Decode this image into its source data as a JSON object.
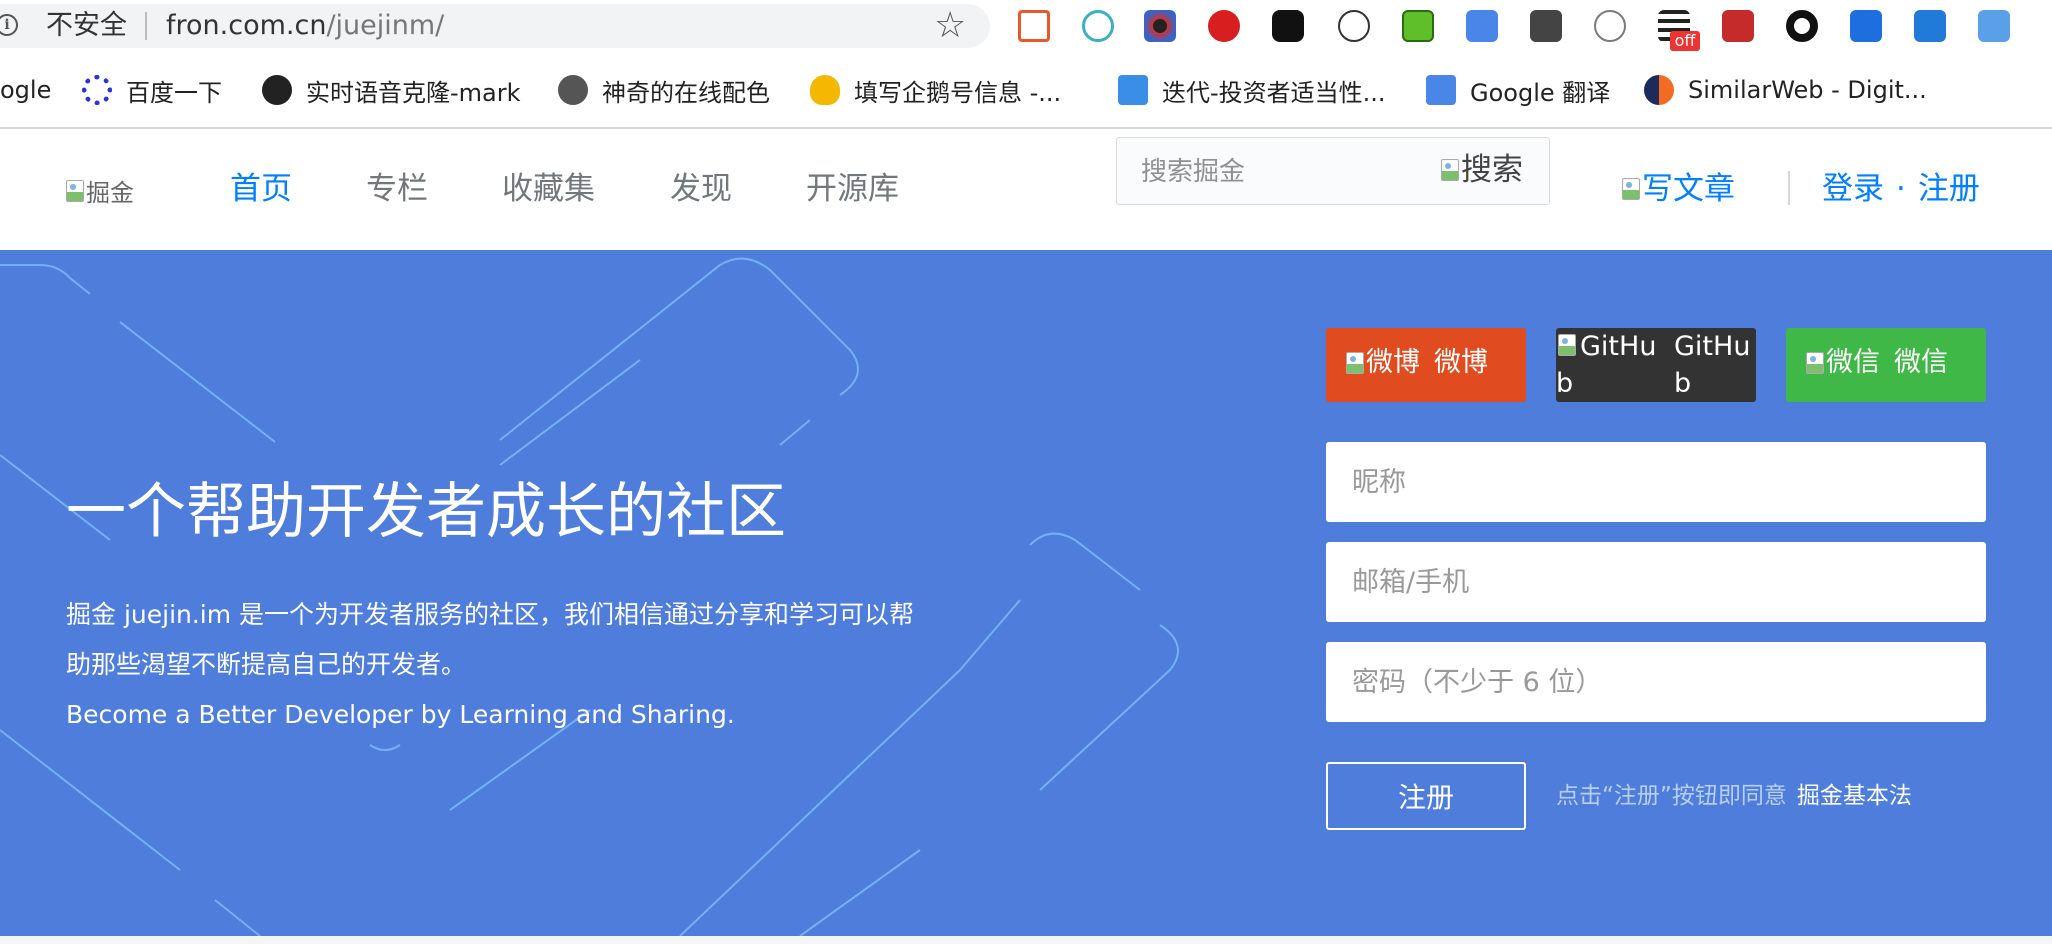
{
  "browser": {
    "security_label": "不安全",
    "url_host": "fron.com.cn",
    "url_path": "/juejinm/",
    "extension_badge": "off",
    "bookmarks": [
      {
        "label": "ogle",
        "icon": "google-icon"
      },
      {
        "label": "百度一下",
        "icon": "baidu-icon"
      },
      {
        "label": "实时语音克隆-mark",
        "icon": "github-icon"
      },
      {
        "label": "神奇的在线配色",
        "icon": "globe-icon"
      },
      {
        "label": "填写企鹅号信息 -...",
        "icon": "qq-penguin-icon"
      },
      {
        "label": "迭代-投资者适当性...",
        "icon": "tapd-icon"
      },
      {
        "label": "Google 翻译",
        "icon": "google-translate-icon"
      },
      {
        "label": "SimilarWeb - Digit...",
        "icon": "similarweb-icon"
      }
    ]
  },
  "header": {
    "logo_alt": "掘金",
    "nav": [
      "首页",
      "专栏",
      "收藏集",
      "发现",
      "开源库"
    ],
    "search_placeholder": "搜索掘金",
    "search_button_alt": "搜索",
    "write_label": "写文章",
    "login_label": "登录",
    "dot": "·",
    "register_label": "注册"
  },
  "hero": {
    "title": "一个帮助开发者成长的社区",
    "desc_line1": "掘金 juejin.im 是一个为开发者服务的社区，我们相信通过分享和学习可以帮",
    "desc_line2": "助那些渴望不断提高自己的开发者。",
    "desc_en": "Become a Better Developer by Learning and Sharing."
  },
  "signup": {
    "weibo_alt": "微博",
    "weibo_label": "微博",
    "github_alt": "GitHub",
    "github_label": "GitHub",
    "wechat_alt": "微信",
    "wechat_label": "微信",
    "nickname_placeholder": "昵称",
    "email_placeholder": "邮箱/手机",
    "password_placeholder": "密码（不少于 6 位）",
    "register_button": "注册",
    "agree_text": "点击“注册”按钮即同意",
    "agree_link": "掘金基本法"
  },
  "colors": {
    "hero_bg": "#4e7ddb",
    "nav_active": "#007fff",
    "weibo": "#e04c1f",
    "github": "#333333",
    "wechat": "#3fb847"
  }
}
